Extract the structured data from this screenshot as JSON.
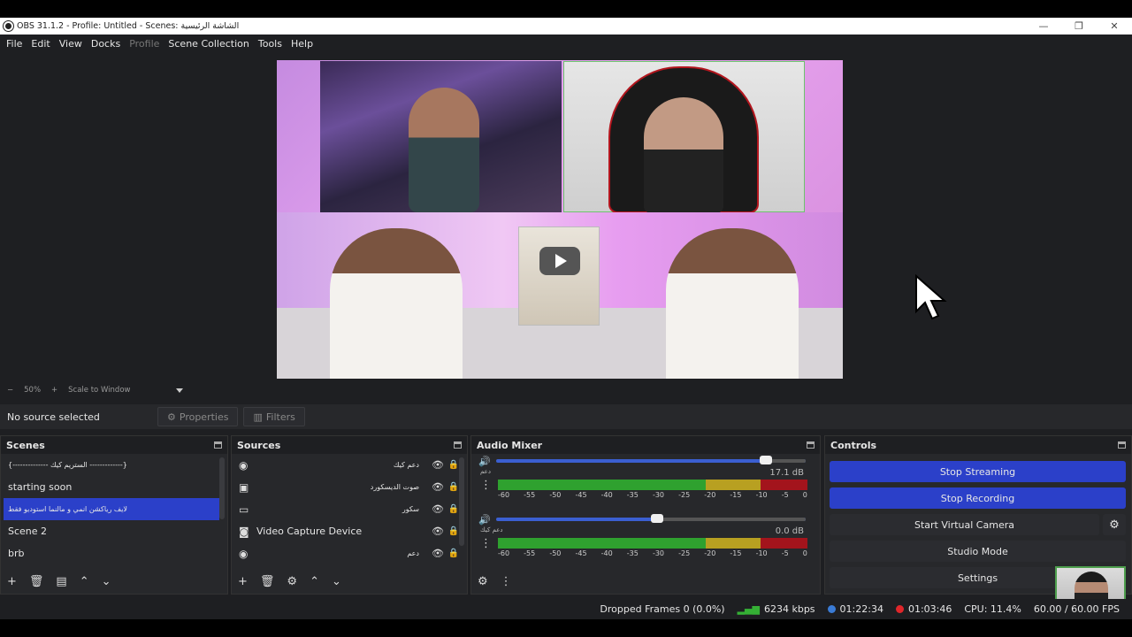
{
  "window": {
    "title": "OBS 31.1.2 - Profile: Untitled - Scenes: الشاشة الرئيسية"
  },
  "menu": [
    "File",
    "Edit",
    "View",
    "Docks",
    "Profile",
    "Scene Collection",
    "Tools",
    "Help"
  ],
  "zoom": {
    "minus": "−",
    "level": "50%",
    "plus": "+",
    "mode": "Scale to Window"
  },
  "source_bar": {
    "no_source": "No source selected",
    "properties": "Properties",
    "filters": "Filters"
  },
  "scenes": {
    "title": "Scenes",
    "items": [
      "{-------------- الستريم كيك -------------}",
      "starting soon",
      "لايف رياكشن انمي و مالنما  استوديو فقط",
      "Scene 2",
      "brb"
    ],
    "selected_index": 2
  },
  "sources": {
    "title": "Sources",
    "items": [
      {
        "icon": "browser-icon",
        "name": "دعم كيك"
      },
      {
        "icon": "audio-output-icon",
        "name": "صوت الديسكورد"
      },
      {
        "icon": "display-capture-icon",
        "name": "سكور"
      },
      {
        "icon": "camera-icon",
        "name": "Video Capture Device"
      },
      {
        "icon": "browser-icon",
        "name": "دعم"
      }
    ]
  },
  "mixer": {
    "title": "Audio Mixer",
    "channels": [
      {
        "name": "دعم",
        "db": "17.1 dB",
        "volume_fraction": 0.87
      },
      {
        "name": "دعم كيك",
        "db": "0.0 dB",
        "volume_fraction": 0.52
      }
    ],
    "ticks": [
      "-60",
      "-55",
      "-50",
      "-45",
      "-40",
      "-35",
      "-30",
      "-25",
      "-20",
      "-15",
      "-10",
      "-5",
      "0"
    ]
  },
  "controls": {
    "title": "Controls",
    "stop_streaming": "Stop Streaming",
    "stop_recording": "Stop Recording",
    "start_virtual_camera": "Start Virtual Camera",
    "studio_mode": "Studio Mode",
    "settings": "Settings"
  },
  "status": {
    "dropped_frames": "Dropped Frames 0 (0.0%)",
    "bitrate": "6234 kbps",
    "stream_time": "01:22:34",
    "record_time": "01:03:46",
    "cpu": "CPU: 11.4%",
    "fps": "60.00 / 60.00 FPS"
  },
  "colors": {
    "accent": "#2b40c9",
    "panel": "#27282b",
    "background": "#1e1f22",
    "meter_green": "#2fa12f",
    "meter_yellow": "#b8a021",
    "meter_red": "#a3141c"
  }
}
